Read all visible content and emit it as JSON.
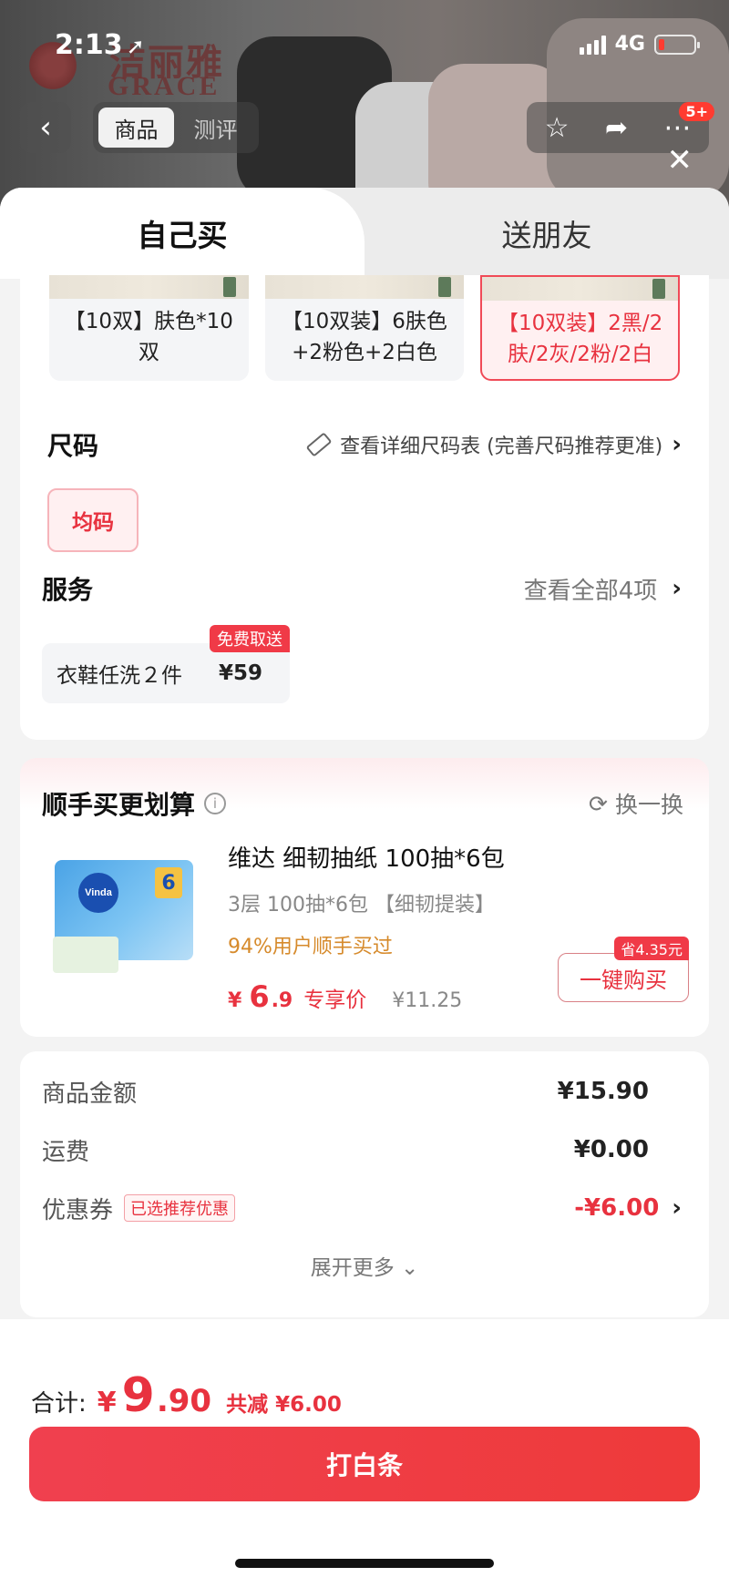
{
  "status_bar": {
    "time": "2:13",
    "network": "4G"
  },
  "backdrop": {
    "brand_cn": "洁丽雅",
    "brand_en": "GRACE"
  },
  "top_nav": {
    "tabs": [
      {
        "label": "商品",
        "active": true
      },
      {
        "label": "测评",
        "active": false
      }
    ],
    "message_badge": "5+"
  },
  "mode_tabs": [
    {
      "label": "自己买",
      "active": true
    },
    {
      "label": "送朋友",
      "active": false
    }
  ],
  "variants": [
    {
      "label": "【10双】肤色*10双",
      "selected": false
    },
    {
      "label": "【10双装】6肤色+2粉色+2白色",
      "selected": false
    },
    {
      "label": "【10双装】2黑/2肤/2灰/2粉/2白",
      "selected": true
    }
  ],
  "size": {
    "title": "尺码",
    "chart_link": "查看详细尺码表 (完善尺码推荐更准)",
    "options": [
      {
        "label": "均码",
        "selected": true
      }
    ]
  },
  "service": {
    "title": "服务",
    "more_label": "查看全部4项",
    "item": {
      "name": "衣鞋任洗２件",
      "price": "¥59",
      "tag": "免费取送"
    }
  },
  "upsell": {
    "title": "顺手买更划算",
    "refresh_label": "换一换",
    "product": {
      "name": "维达 细韧抽纸 100抽*6包",
      "spec": "3层 100抽*6包 【细韧提装】",
      "rate": "94%用户顺手买过",
      "currency": "¥",
      "price_int": "6",
      "price_dec": ".9",
      "price_label": "专享价",
      "original_price": "¥11.25",
      "save_tag": "省4.35元",
      "buy_label": "一键购买",
      "brand_on_pack": "Vinda",
      "pack_count": "6"
    }
  },
  "summary": {
    "rows": [
      {
        "label": "商品金额",
        "value": "¥15.90"
      },
      {
        "label": "运费",
        "value": "¥0.00"
      },
      {
        "label": "优惠券",
        "tag": "已选推荐优惠",
        "value": "-¥6.00"
      }
    ],
    "expand_label": "展开更多"
  },
  "footer": {
    "total_label": "合计:",
    "currency": "¥",
    "total_int": "9",
    "total_dec": ".90",
    "discount": "共减 ¥6.00",
    "pay_label": "打白条"
  },
  "colors": {
    "accent": "#e8323f",
    "pay_button": "#f0404f",
    "rate_text": "#d68a2b"
  }
}
